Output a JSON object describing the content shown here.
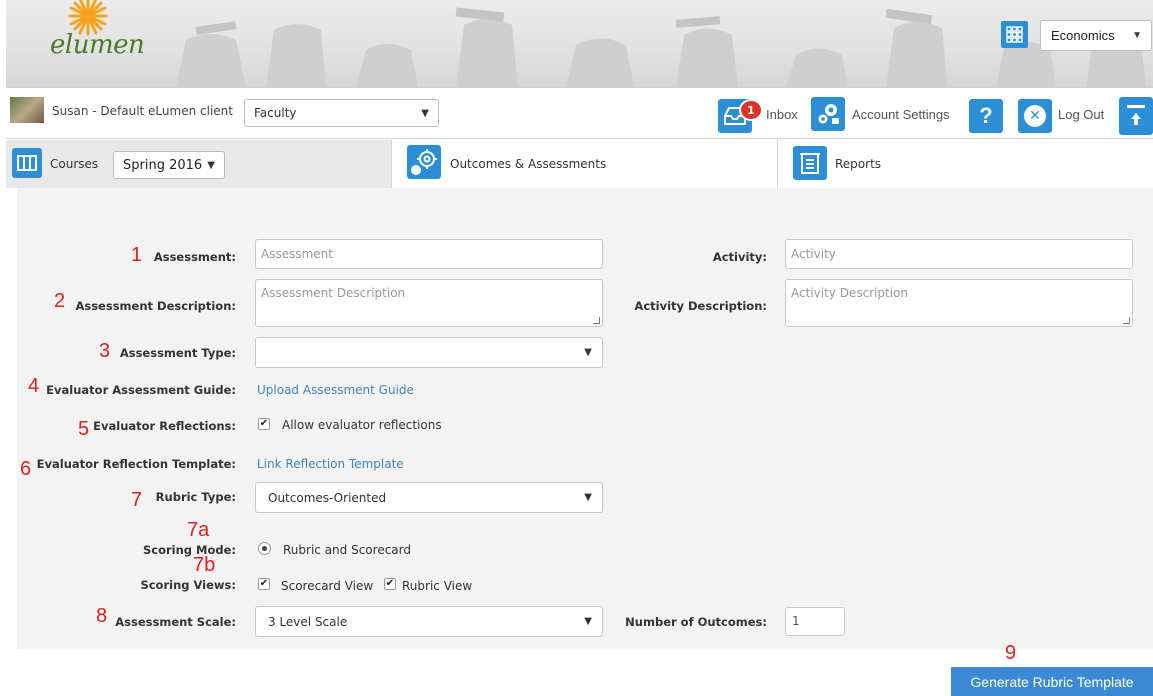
{
  "header": {
    "logo_text": "elumen",
    "department_select": "Economics"
  },
  "userbar": {
    "user_name": "Susan - Default eLumen client",
    "role_select": "Faculty",
    "inbox_badge": "1",
    "inbox_label": "Inbox",
    "account_settings_label": "Account Settings",
    "help_glyph": "?",
    "logout_glyph": "✕",
    "logout_label": "Log Out"
  },
  "nav": {
    "courses_label": "Courses",
    "term_select": "Spring 2016",
    "outcomes_label": "Outcomes & Assessments",
    "reports_label": "Reports"
  },
  "form": {
    "assessment_label": "Assessment:",
    "assessment_placeholder": "Assessment",
    "activity_label": "Activity:",
    "activity_placeholder": "Activity",
    "assessment_desc_label": "Assessment Description:",
    "assessment_desc_placeholder": "Assessment Description",
    "activity_desc_label": "Activity Description:",
    "activity_desc_placeholder": "Activity Description",
    "assessment_type_label": "Assessment Type:",
    "assessment_type_value": "",
    "guide_label": "Evaluator Assessment Guide:",
    "guide_link": "Upload Assessment Guide",
    "reflections_label": "Evaluator Reflections:",
    "reflections_option": "Allow evaluator reflections",
    "reflection_template_label": "Evaluator Reflection Template:",
    "reflection_template_link": "Link Reflection Template",
    "rubric_type_label": "Rubric Type:",
    "rubric_type_value": "Outcomes-Oriented",
    "scoring_mode_label": "Scoring Mode:",
    "scoring_mode_option": "Rubric and Scorecard",
    "scoring_views_label": "Scoring Views:",
    "scorecard_view": "Scorecard View",
    "rubric_view": "Rubric View",
    "scale_label": "Assessment Scale:",
    "scale_value": "3 Level Scale",
    "outcomes_count_label": "Number of Outcomes:",
    "outcomes_count_value": "1"
  },
  "annotations": [
    "1",
    "2",
    "3",
    "4",
    "5",
    "6",
    "7",
    "7a",
    "7b",
    "8",
    "9"
  ],
  "generate_button": "Generate Rubric Template",
  "colors": {
    "accent_blue": "#2c8fd6",
    "link_blue": "#3f84c4",
    "annotation_red": "#e0201f",
    "button_blue": "#3d8ad4",
    "panel_bg": "#f3f3f3"
  }
}
